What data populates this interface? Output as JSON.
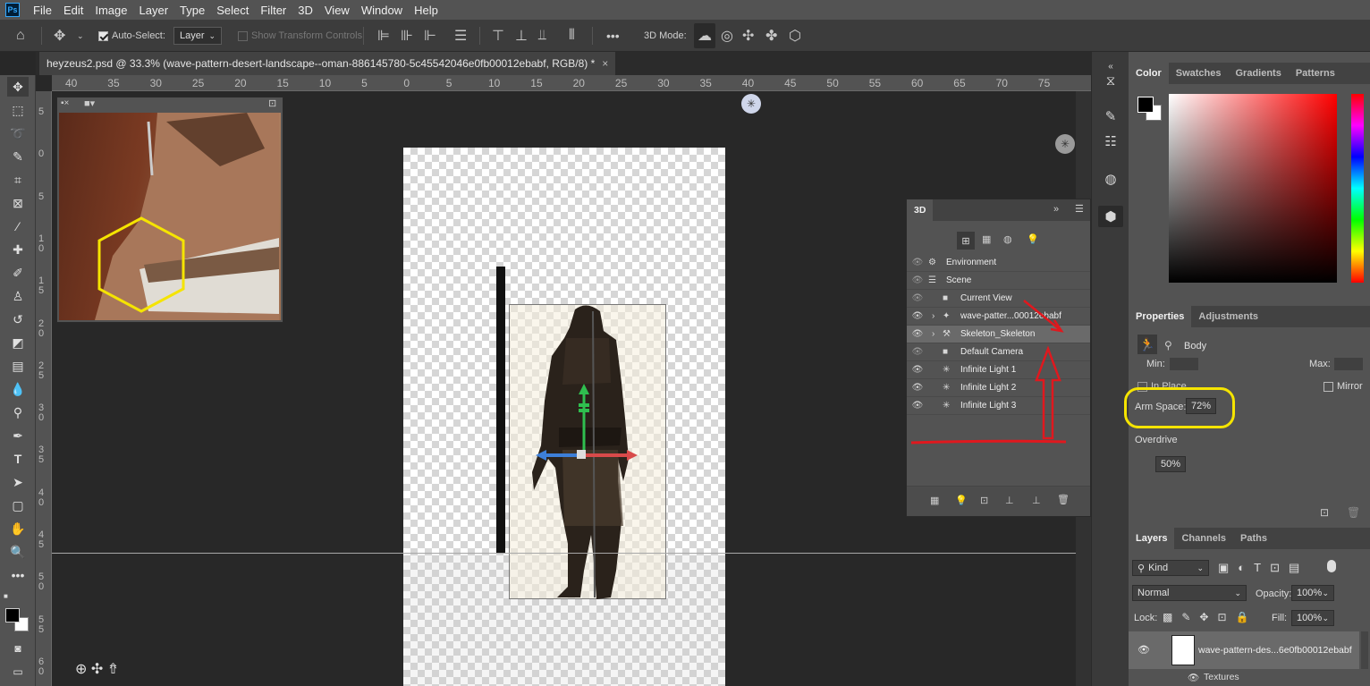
{
  "menu": [
    "File",
    "Edit",
    "Image",
    "Layer",
    "Type",
    "Select",
    "Filter",
    "3D",
    "View",
    "Window",
    "Help"
  ],
  "options": {
    "auto_select_label": "Auto-Select:",
    "auto_select_target": "Layer",
    "transform_controls_label": "Show Transform Controls",
    "mode_label": "3D Mode:",
    "more": "•••"
  },
  "document": {
    "tab_title": "heyzeus2.psd @ 33.3% (wave-pattern-desert-landscape--oman-886145780-5c45542046e0fb00012ebabf, RGB/8) *",
    "close": "×"
  },
  "ruler_top": [
    "40",
    "35",
    "30",
    "25",
    "20",
    "15",
    "10",
    "5",
    "0",
    "5",
    "10",
    "15",
    "20",
    "25",
    "30",
    "35",
    "40",
    "45",
    "50",
    "55",
    "60",
    "65",
    "70",
    "75"
  ],
  "ruler_left": [
    "5",
    "0",
    "5",
    "1 0",
    "1 5",
    "2 0",
    "2 5",
    "3 0",
    "3 5",
    "4 0",
    "4 5",
    "5 0",
    "5 5",
    "6 0"
  ],
  "panel3d": {
    "title": "3D",
    "items": [
      {
        "label": "Environment",
        "indent": 0,
        "eye": false,
        "icon": "environment-icon",
        "expand": false
      },
      {
        "label": "Scene",
        "indent": 0,
        "eye": false,
        "icon": "scene-icon",
        "expand": false
      },
      {
        "label": "Current View",
        "indent": 1,
        "eye": false,
        "icon": "camera-icon",
        "expand": false
      },
      {
        "label": "wave-patter...00012ebabf",
        "indent": 1,
        "eye": true,
        "icon": "mesh-icon",
        "expand": true
      },
      {
        "label": "Skeleton_Skeleton",
        "indent": 1,
        "eye": true,
        "icon": "skeleton-icon",
        "expand": true
      },
      {
        "label": "Default Camera",
        "indent": 1,
        "eye": false,
        "icon": "camera-icon",
        "expand": false
      },
      {
        "label": "Infinite Light 1",
        "indent": 1,
        "eye": true,
        "icon": "light-icon",
        "expand": false
      },
      {
        "label": "Infinite Light 2",
        "indent": 1,
        "eye": true,
        "icon": "light-icon",
        "expand": false
      },
      {
        "label": "Infinite Light 3",
        "indent": 1,
        "eye": true,
        "icon": "light-icon",
        "expand": false
      }
    ]
  },
  "color_panel": {
    "tabs": [
      "Color",
      "Swatches",
      "Gradients",
      "Patterns"
    ],
    "foreground": "#000000",
    "background": "#ffffff",
    "hue": "#ff0000"
  },
  "properties": {
    "tabs": [
      "Properties",
      "Adjustments"
    ],
    "section": "Body",
    "min_label": "Min:",
    "max_label": "Max:",
    "in_place_label": "In Place",
    "mirror_label": "Mirror",
    "arm_space_label": "Arm Space:",
    "arm_space_value": "72%",
    "overdrive_label": "Overdrive",
    "overdrive_value": "50%"
  },
  "layers": {
    "tabs": [
      "Layers",
      "Channels",
      "Paths"
    ],
    "filter_kind": "Kind",
    "blend_mode": "Normal",
    "opacity_label": "Opacity:",
    "opacity_value": "100%",
    "lock_label": "Lock:",
    "fill_label": "Fill:",
    "fill_value": "100%",
    "layer_name": "wave-pattern-des...6e0fb00012ebabf",
    "sublayer": "Textures"
  },
  "annotation_colors": {
    "highlight": "#ffff00",
    "arrow": "#e0181e"
  }
}
